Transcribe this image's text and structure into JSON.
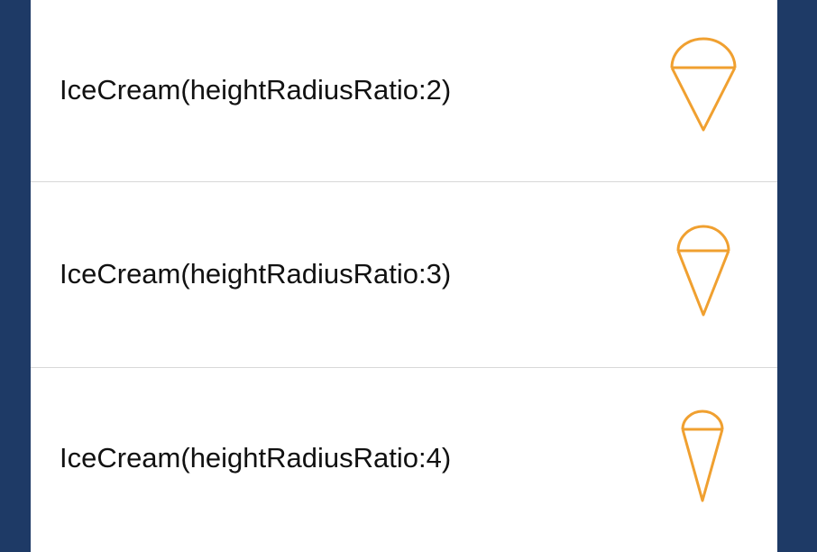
{
  "colors": {
    "frame_background": "#1e3a66",
    "list_background": "#ffffff",
    "divider": "#d8d8d8",
    "icon_stroke": "#f0a030",
    "text": "#111111"
  },
  "rows": [
    {
      "label": "IceCream(heightRadiusRatio:2)",
      "icon": "ice-cream-cone-icon",
      "height_radius_ratio": 2
    },
    {
      "label": "IceCream(heightRadiusRatio:3)",
      "icon": "ice-cream-cone-icon",
      "height_radius_ratio": 3
    },
    {
      "label": "IceCream(heightRadiusRatio:4)",
      "icon": "ice-cream-cone-icon",
      "height_radius_ratio": 4
    }
  ]
}
